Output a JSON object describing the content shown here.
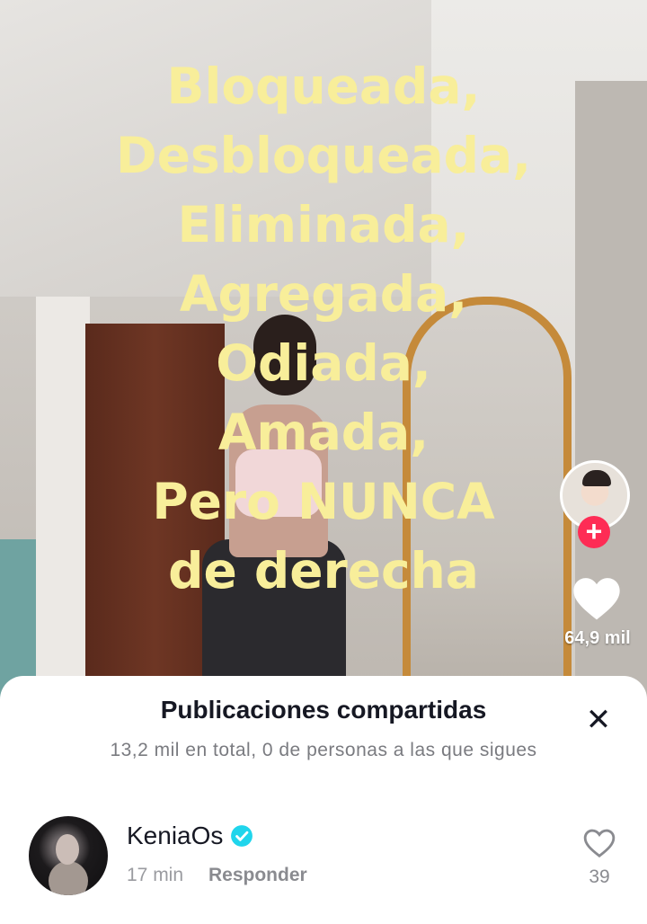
{
  "video": {
    "overlay_lines": [
      "Bloqueada,",
      "Desbloqueada,",
      "Eliminada,",
      "Agregada,",
      "Odiada,",
      "Amada,",
      "Pero NUNCA",
      "de derecha"
    ],
    "overlay_color": "#f8ee9a"
  },
  "rail": {
    "follow_symbol": "+",
    "like_count": "64,9 mil",
    "accent_color": "#fe2c55"
  },
  "sheet": {
    "title": "Publicaciones compartidas",
    "close_symbol": "✕",
    "subtitle": "13,2 mil en total, 0 de personas a las que sigues"
  },
  "comment": {
    "username": "KeniaOs",
    "time": "17 min",
    "reply_label": "Responder",
    "like_count": "39",
    "verified_color": "#20d5ec"
  }
}
